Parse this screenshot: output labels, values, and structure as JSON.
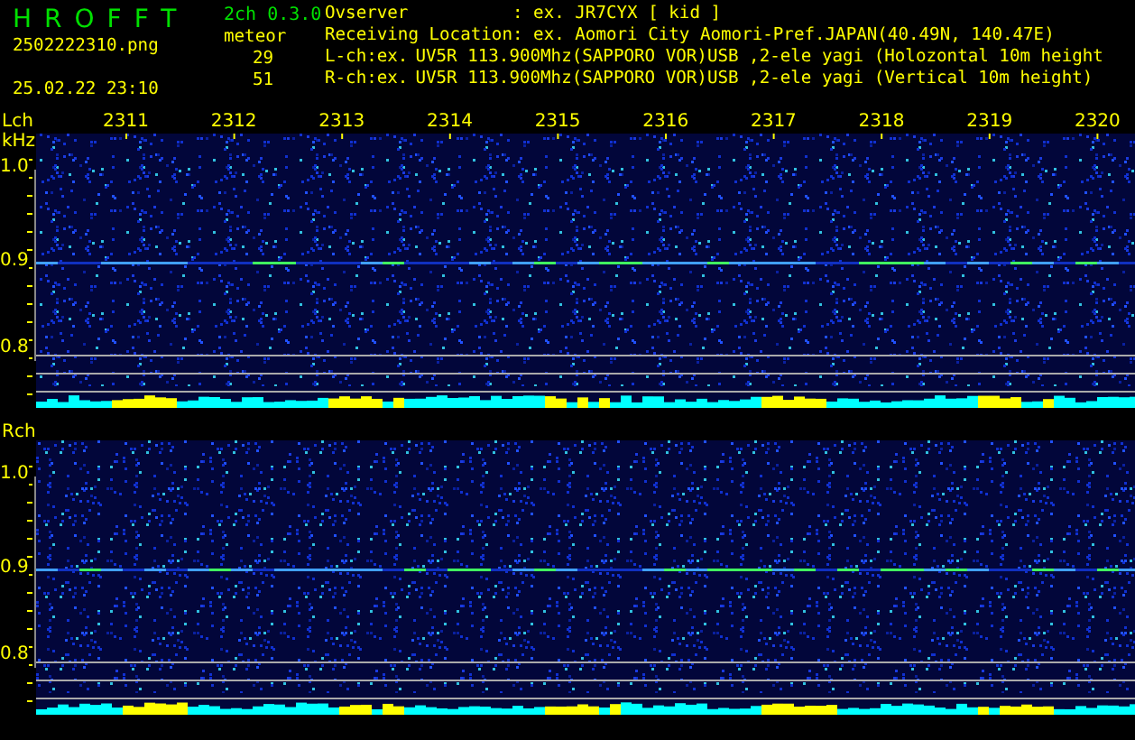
{
  "app": {
    "title": "HROFFT",
    "version": "2ch 0.3.0"
  },
  "file": {
    "name": "2502222310.png",
    "datetime": "25.02.22 23:10"
  },
  "meteor": {
    "label": "meteor",
    "counts": [
      "29",
      "51"
    ]
  },
  "info_lines": [
    {
      "label": "Ovserver",
      "value": ": ex. JR7CYX [ kid ]"
    },
    {
      "label": "Receiving Location",
      "value": ": ex. Aomori City Aomori-Pref.JAPAN(40.49N, 140.47E)"
    },
    {
      "label": "L-ch:ex.",
      "value": "UV5R 113.900Mhz(SAPPORO VOR)USB ,2-ele yagi (Holozontal 10m height"
    },
    {
      "label": "R-ch:ex.",
      "value": "UV5R 113.900Mhz(SAPPORO VOR)USB ,2-ele yagi (Vertical 10m height)"
    }
  ],
  "time_labels": [
    "2311",
    "2312",
    "2313",
    "2314",
    "2315",
    "2316",
    "2317",
    "2318",
    "2319",
    "2320"
  ],
  "channels": [
    {
      "label": "Lch",
      "unit": "kHz",
      "y_labels": [
        "1.0",
        "0.9",
        "0.8"
      ]
    },
    {
      "label": "Rch",
      "y_labels": [
        "1.0",
        "0.9",
        "0.8"
      ]
    }
  ]
}
